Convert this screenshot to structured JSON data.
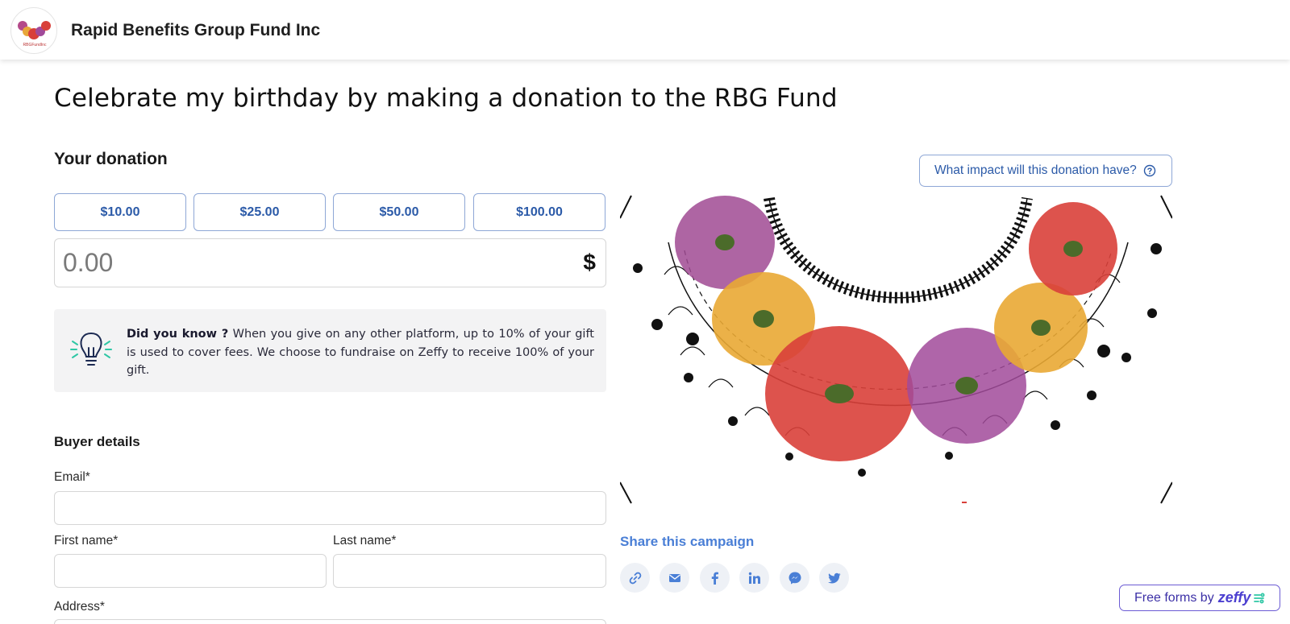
{
  "header": {
    "org_name": "Rapid Benefits Group Fund Inc",
    "logo_text": "RBGFundInc"
  },
  "page": {
    "title": "Celebrate my birthday by making a donation to the RBG Fund"
  },
  "donation": {
    "section_title": "Your donation",
    "amounts": [
      "$10.00",
      "$25.00",
      "$50.00",
      "$100.00"
    ],
    "amount_placeholder": "0.00",
    "currency_symbol": "$"
  },
  "did_you_know": {
    "lead": "Did you know ?",
    "text": " When you give on any other platform, up to 10% of your gift is used to cover fees. We choose to fundraise on Zeffy to receive 100% of your gift."
  },
  "buyer": {
    "section_title": "Buyer details",
    "email_label": "Email*",
    "first_name_label": "First name*",
    "last_name_label": "Last name*",
    "address_label": "Address*"
  },
  "impact": {
    "button_label": "What impact will this donation have?"
  },
  "share": {
    "title": "Share this campaign",
    "icons": [
      "link-icon",
      "mail-icon",
      "facebook-icon",
      "linkedin-icon",
      "messenger-icon",
      "twitter-icon"
    ]
  },
  "footer": {
    "free_forms_label": "Free forms by",
    "brand": "zeffy"
  },
  "colors": {
    "accent_blue": "#2b5aa8",
    "share_blue": "#4a7fd6",
    "zeffy_purple": "#4b3fd0",
    "bulb_teal": "#2fc7a5"
  }
}
